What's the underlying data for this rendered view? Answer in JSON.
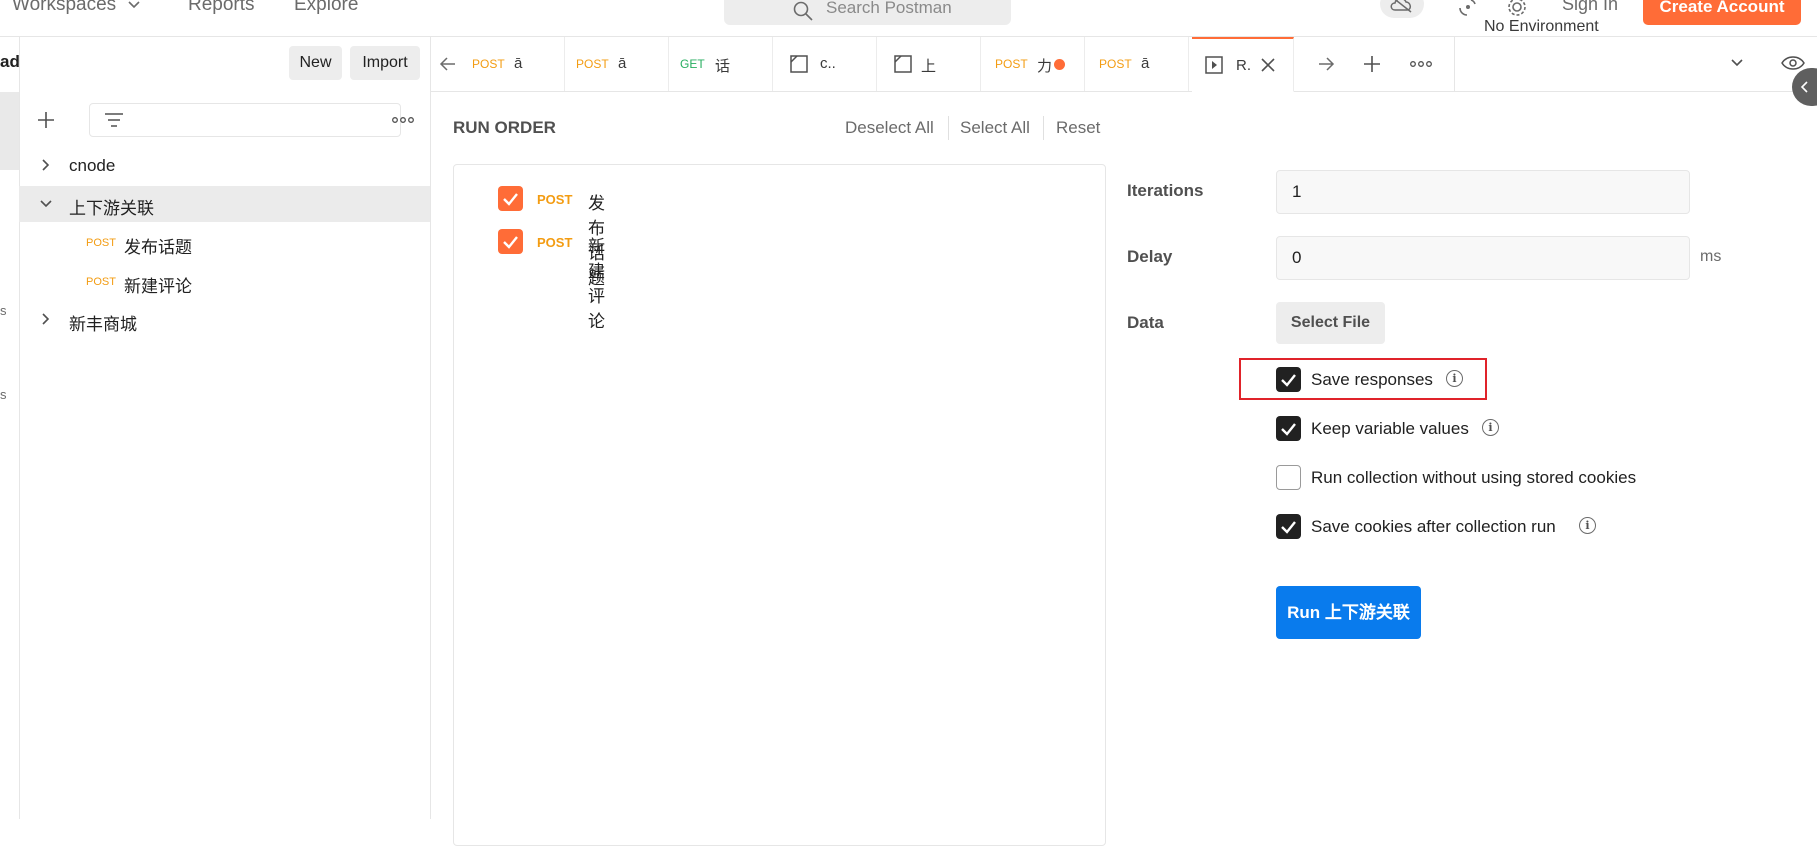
{
  "topbar": {
    "workspaces": "Workspaces",
    "reports": "Reports",
    "explore": "Explore",
    "search_placeholder": "Search Postman",
    "sign_in": "Sign In",
    "create_account": "Create Account"
  },
  "sidebar": {
    "workspace_name_fragment": "ad",
    "new_label": "New",
    "import_label": "Import",
    "strip_fragments": [
      "s",
      "s"
    ],
    "tree": [
      {
        "label": "cnode"
      },
      {
        "label": "上下游关联"
      },
      {
        "method": "POST",
        "label": "发布话题"
      },
      {
        "method": "POST",
        "label": "新建评论"
      },
      {
        "label": "新丰商城"
      }
    ]
  },
  "tabs": [
    {
      "method": "POST",
      "title": "ā",
      "method_color": "#f39c12"
    },
    {
      "method": "POST",
      "title": "ā",
      "method_color": "#f39c12"
    },
    {
      "method": "GET",
      "title": "话",
      "method_color": "#27ae60"
    },
    {
      "title": "c.."
    },
    {
      "title": "上"
    },
    {
      "method": "POST",
      "title": "力",
      "method_color": "#f39c12"
    },
    {
      "method": "POST",
      "title": "ā",
      "method_color": "#f39c12"
    },
    {
      "title": "R."
    }
  ],
  "environment": "No Environment",
  "run_order": {
    "title": "RUN ORDER",
    "deselect_all": "Deselect All",
    "select_all": "Select All",
    "reset": "Reset",
    "requests": [
      {
        "method": "POST",
        "name": "发布话题",
        "checked": true
      },
      {
        "method": "POST",
        "name": "新建评论",
        "checked": true
      }
    ]
  },
  "settings": {
    "iterations_label": "Iterations",
    "iterations_value": "1",
    "delay_label": "Delay",
    "delay_value": "0",
    "delay_unit": "ms",
    "data_label": "Data",
    "select_file": "Select File",
    "options": [
      {
        "label": "Save responses",
        "checked": true,
        "info": true
      },
      {
        "label": "Keep variable values",
        "checked": true,
        "info": true
      },
      {
        "label": "Run collection without using stored cookies",
        "checked": false,
        "info": false
      },
      {
        "label": "Save cookies after collection run",
        "checked": true,
        "info": true
      }
    ],
    "run_button": "Run 上下游关联"
  },
  "colors": {
    "accent": "#ff6c37",
    "primary_button": "#097bed",
    "post_method": "#f39c12",
    "get_method": "#27ae60",
    "highlight_box": "#e0232a"
  }
}
